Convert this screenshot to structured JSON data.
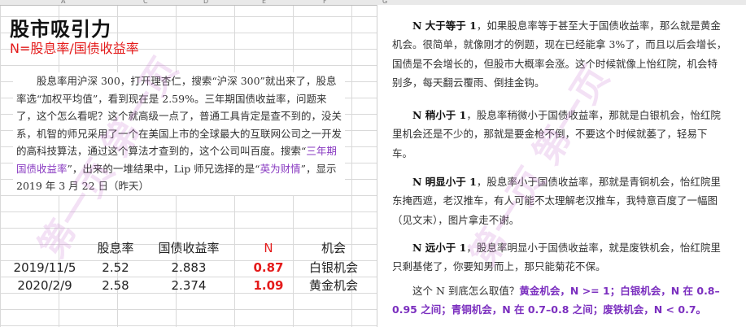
{
  "column_headers": [
    "A",
    "C",
    "D",
    "E",
    "F",
    "G"
  ],
  "sheet": {
    "title": "股市吸引力",
    "formula": "N=股息率/国债收益率",
    "left_paragraph": {
      "part1": "股息率用沪深 300，打开理杏仁，搜索“沪深 300”就出来了，股息率选“加权平均值”，看到现在是 2.59%。三年期国债收益率，问题来了，这个怎么看呢？这个就高级一点了，普通工具肯定是查不到的，没关系，机智的师兄采用了一个在美国上市的全球最大的互联网公司之一开发的高科技算法，通过这个算法才查到的，这个公司叫百度。搜索“",
      "highlight1": "三年期国债收益率",
      "part2": "”，出来的一堆结果中，Lip 师兄选择的是“",
      "highlight2": "英为财情",
      "part3": "”，显示 2019 年 3 月 22 日（昨天）"
    },
    "table": {
      "headers": [
        "",
        "股息率",
        "国债收益率",
        "N",
        "机会"
      ],
      "rows": [
        {
          "date": "2019/11/5",
          "dividend": "2.52",
          "bond": "2.883",
          "n": "0.87",
          "chance": "白银机会"
        },
        {
          "date": "2020/2/9",
          "dividend": "2.58",
          "bond": "2.374",
          "n": "1.09",
          "chance": "黄金机会"
        }
      ]
    }
  },
  "right": {
    "p1_bold": "N 大于等于 1",
    "p1_text": "，如果股息率等于甚至大于国债收益率，那么就是黄金机会。很简单，就像刚才的例题，现在已经能拿 3%了，而且以后会增长，国债是不会增长的，但股市大概率会涨。这个时候就像上怡红院，机会特别多，每天翻云覆雨、倒挂金钩。",
    "p2_bold": "N 稍小于 1",
    "p2_text": "，股息率稍微小于国债收益率，那就是白银机会，怡红院里机会还是不少的，那就是要金枪不倒，不要这个时候就萎了，轻易下车。",
    "p3_bold": "N 明显小于 1",
    "p3_text": "，股息率小于国债收益率，那就是青铜机会，怡红院里东掩西遮，老汉推车，有人可能不太理解老汉推车，我特意百度了一幅图（见文末），图片拿走不谢。",
    "p4_bold": "N 远小于 1",
    "p4_text": "，股息率明显小于国债收益率，就是废铁机会，怡红院里只剩基佬了，你要知男而上，那只能菊花不保。",
    "p5_lead": "这个 N 到底怎么取值？",
    "p5_summary": "黄金机会，N >= 1；白银机会，N 在 0.8–0.95 之间；青铜机会，N 在 0.7–0.8 之间；废铁机会，N < 0.7。"
  },
  "watermark": "第一页 第一页"
}
